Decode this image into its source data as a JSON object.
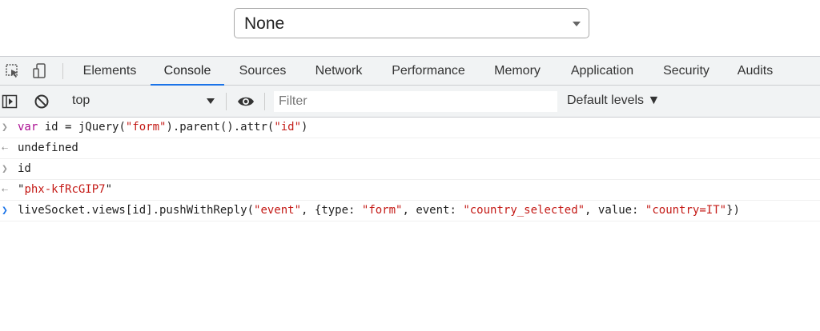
{
  "page": {
    "select_value": "None"
  },
  "devtools": {
    "tabs": [
      "Elements",
      "Console",
      "Sources",
      "Network",
      "Performance",
      "Memory",
      "Application",
      "Security",
      "Audits"
    ],
    "active_tab": "Console",
    "context": "top",
    "filter_placeholder": "Filter",
    "levels_label": "Default levels ▼"
  },
  "console": {
    "lines": [
      {
        "kind": "input",
        "code": "var id = jQuery(\"form\").parent().attr(\"id\")"
      },
      {
        "kind": "output",
        "text": "undefined"
      },
      {
        "kind": "input",
        "code": "id"
      },
      {
        "kind": "output",
        "text": "\"phx-kfRcGIP7\""
      },
      {
        "kind": "prompt",
        "code": "liveSocket.views[id].pushWithReply(\"event\", {type: \"form\", event: \"country_selected\", value: \"country=IT\"})"
      }
    ]
  },
  "colors": {
    "accent": "#1a73e8",
    "keyword": "#aa0d91",
    "string": "#c41a16",
    "toolbar_bg": "#f1f3f4"
  }
}
